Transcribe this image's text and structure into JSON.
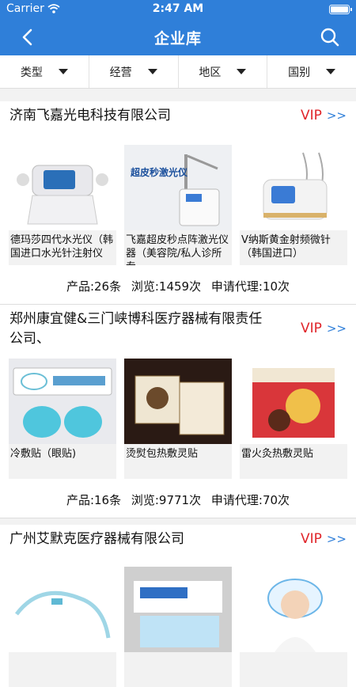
{
  "status": {
    "carrier": "Carrier",
    "time": "2:47 AM"
  },
  "nav": {
    "title": "企业库",
    "back_icon": "chevron-left-icon",
    "search_icon": "search-icon"
  },
  "filters": [
    "类型",
    "经营",
    "地区",
    "国别"
  ],
  "vip": {
    "label": "VIP",
    "arrow": ">>"
  },
  "colors": {
    "primary": "#2f7fd9",
    "vip": "#e0252a"
  },
  "companies": [
    {
      "name": "济南飞嘉光电科技有限公司",
      "products": [
        {
          "name": "德玛莎四代水光仪（韩国进口水光针注射仪"
        },
        {
          "name": "飞嘉超皮秒点阵激光仪器（美容院/私人诊所专",
          "image_text": "超皮秒激光仪"
        },
        {
          "name": "V纳斯黄金射频微针（韩国进口）"
        }
      ],
      "stats": {
        "products": "产品:26条",
        "views": "浏览:1459次",
        "agents": "申请代理:10次"
      }
    },
    {
      "name": "郑州康宜健&三门峡博科医疗器械有限责任公司、",
      "products": [
        {
          "name": "冷敷贴（眼贴)"
        },
        {
          "name": "烫熨包热敷灵贴"
        },
        {
          "name": "雷火灸热敷灵贴"
        }
      ],
      "stats": {
        "products": "产品:16条",
        "views": "浏览:9771次",
        "agents": "申请代理:70次"
      }
    },
    {
      "name": "广州艾默克医疗器械有限公司",
      "products": [
        {
          "name": ""
        },
        {
          "name": ""
        },
        {
          "name": ""
        }
      ]
    }
  ]
}
